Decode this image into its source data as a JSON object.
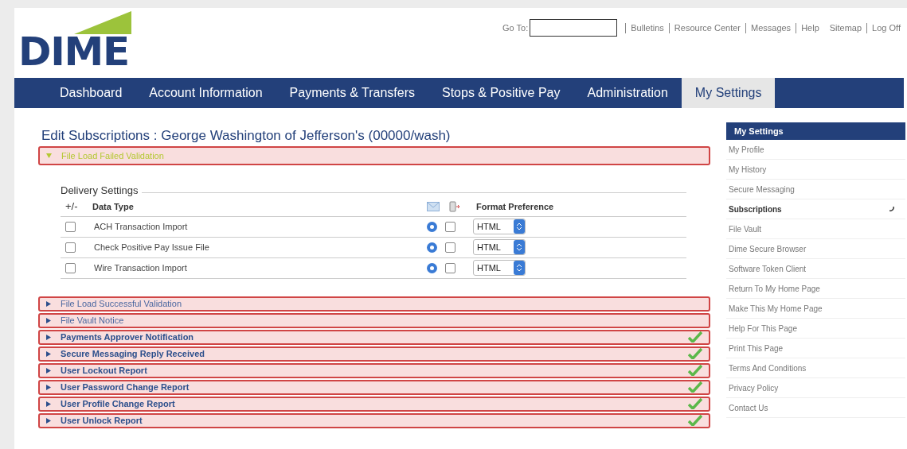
{
  "logo": {
    "text": "DIME"
  },
  "top_links": {
    "goto_label": "Go To:",
    "links": [
      {
        "label": "Bulletins",
        "divider_before": true
      },
      {
        "label": "Resource Center",
        "divider_before": true
      },
      {
        "label": "Messages",
        "divider_before": true
      },
      {
        "label": "Help",
        "divider_before": true
      },
      {
        "label": "Sitemap",
        "divider_before": false
      },
      {
        "label": "Log Off",
        "divider_before": true
      }
    ]
  },
  "nav": [
    {
      "label": "Dashboard",
      "selected": false
    },
    {
      "label": "Account Information",
      "selected": false
    },
    {
      "label": "Payments & Transfers",
      "selected": false
    },
    {
      "label": "Stops & Positive Pay",
      "selected": false
    },
    {
      "label": "Administration",
      "selected": false
    },
    {
      "label": "My Settings",
      "selected": true
    }
  ],
  "title": "Edit Subscriptions : George Washington of Jefferson's (00000/wash)",
  "sections": [
    {
      "label": "File Load Failed Validation",
      "expanded": true,
      "subscribed": false,
      "delivery": {
        "title": "Delivery Settings",
        "columns": {
          "toggle": "+/-",
          "data_type": "Data Type",
          "format": "Format Preference"
        },
        "rows": [
          {
            "label": "ACH Transaction Import",
            "checked": false,
            "email": true,
            "mobile": false,
            "format": "HTML"
          },
          {
            "label": "Check Positive Pay Issue File",
            "checked": false,
            "email": true,
            "mobile": false,
            "format": "HTML"
          },
          {
            "label": "Wire Transaction Import",
            "checked": false,
            "email": true,
            "mobile": false,
            "format": "HTML"
          }
        ]
      }
    },
    {
      "label": "File Load Successful Validation",
      "expanded": false,
      "subscribed": false
    },
    {
      "label": "File Vault Notice",
      "expanded": false,
      "subscribed": false
    },
    {
      "label": "Payments Approver Notification",
      "expanded": false,
      "subscribed": true
    },
    {
      "label": "Secure Messaging Reply Received",
      "expanded": false,
      "subscribed": true
    },
    {
      "label": "User Lockout Report",
      "expanded": false,
      "subscribed": true
    },
    {
      "label": "User Password Change Report",
      "expanded": false,
      "subscribed": true
    },
    {
      "label": "User Profile Change Report",
      "expanded": false,
      "subscribed": true
    },
    {
      "label": "User Unlock Report",
      "expanded": false,
      "subscribed": true
    }
  ],
  "sidebar": {
    "title": "My Settings",
    "items": [
      {
        "label": "My Profile",
        "selected": false
      },
      {
        "label": "My History",
        "selected": false
      },
      {
        "label": "Secure Messaging",
        "selected": false
      },
      {
        "label": "Subscriptions",
        "selected": true
      },
      {
        "label": "File Vault",
        "selected": false
      },
      {
        "label": "Dime Secure Browser",
        "selected": false
      },
      {
        "label": "Software Token Client",
        "selected": false
      },
      {
        "label": "Return To My Home Page",
        "selected": false
      },
      {
        "label": "Make This My Home Page",
        "selected": false
      },
      {
        "label": "Help For This Page",
        "selected": false
      },
      {
        "label": "Print This Page",
        "selected": false
      },
      {
        "label": "Terms And Conditions",
        "selected": false
      },
      {
        "label": "Privacy Policy",
        "selected": false
      },
      {
        "label": "Contact Us",
        "selected": false
      }
    ]
  }
}
